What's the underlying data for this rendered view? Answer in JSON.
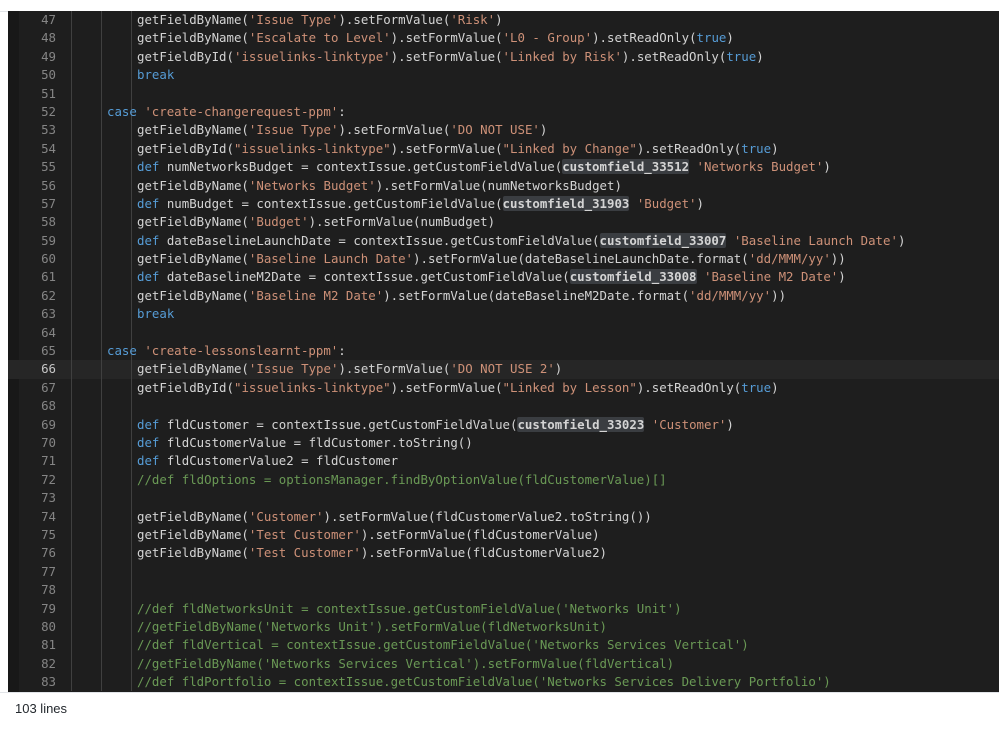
{
  "lines": [
    {
      "n": "47",
      "indent": 2,
      "segs": [
        [
          "t",
          "getFieldByName("
        ],
        [
          "s",
          "'Issue Type'"
        ],
        [
          "t",
          ").setFormValue("
        ],
        [
          "s",
          "'Risk'"
        ],
        [
          "t",
          ")"
        ]
      ]
    },
    {
      "n": "48",
      "indent": 2,
      "segs": [
        [
          "t",
          "getFieldByName("
        ],
        [
          "s",
          "'Escalate to Level'"
        ],
        [
          "t",
          ").setFormValue("
        ],
        [
          "s",
          "'L0 - Group'"
        ],
        [
          "t",
          ").setReadOnly("
        ],
        [
          "k",
          "true"
        ],
        [
          "t",
          ")"
        ]
      ]
    },
    {
      "n": "49",
      "indent": 2,
      "segs": [
        [
          "t",
          "getFieldById("
        ],
        [
          "s",
          "'issuelinks-linktype'"
        ],
        [
          "t",
          ").setFormValue("
        ],
        [
          "s",
          "'Linked by Risk'"
        ],
        [
          "t",
          ").setReadOnly("
        ],
        [
          "k",
          "true"
        ],
        [
          "t",
          ")"
        ]
      ]
    },
    {
      "n": "50",
      "indent": 2,
      "segs": [
        [
          "k",
          "break"
        ]
      ]
    },
    {
      "n": "51",
      "indent": 0,
      "segs": []
    },
    {
      "n": "52",
      "indent": 1,
      "segs": [
        [
          "k",
          "case "
        ],
        [
          "s",
          "'create-changerequest-ppm'"
        ],
        [
          "t",
          ":"
        ]
      ]
    },
    {
      "n": "53",
      "indent": 2,
      "segs": [
        [
          "t",
          "getFieldByName("
        ],
        [
          "s",
          "'Issue Type'"
        ],
        [
          "t",
          ").setFormValue("
        ],
        [
          "s",
          "'DO NOT USE'"
        ],
        [
          "t",
          ")"
        ]
      ]
    },
    {
      "n": "54",
      "indent": 2,
      "segs": [
        [
          "t",
          "getFieldById("
        ],
        [
          "s",
          "\"issuelinks-linktype\""
        ],
        [
          "t",
          ").setFormValue("
        ],
        [
          "s",
          "\"Linked by Change\""
        ],
        [
          "t",
          ").setReadOnly("
        ],
        [
          "k",
          "true"
        ],
        [
          "t",
          ")"
        ]
      ]
    },
    {
      "n": "55",
      "indent": 2,
      "segs": [
        [
          "k",
          "def "
        ],
        [
          "t",
          "numNetworksBudget = contextIssue.getCustomFieldValue("
        ],
        [
          "h",
          "customfield_33512"
        ],
        [
          "t",
          " "
        ],
        [
          "s",
          "'Networks Budget'"
        ],
        [
          "t",
          ")"
        ]
      ]
    },
    {
      "n": "56",
      "indent": 2,
      "segs": [
        [
          "t",
          "getFieldByName("
        ],
        [
          "s",
          "'Networks Budget'"
        ],
        [
          "t",
          ").setFormValue(numNetworksBudget)"
        ]
      ]
    },
    {
      "n": "57",
      "indent": 2,
      "segs": [
        [
          "k",
          "def "
        ],
        [
          "t",
          "numBudget = contextIssue.getCustomFieldValue("
        ],
        [
          "h",
          "customfield_31903"
        ],
        [
          "t",
          " "
        ],
        [
          "s",
          "'Budget'"
        ],
        [
          "t",
          ")"
        ]
      ]
    },
    {
      "n": "58",
      "indent": 2,
      "segs": [
        [
          "t",
          "getFieldByName("
        ],
        [
          "s",
          "'Budget'"
        ],
        [
          "t",
          ").setFormValue(numBudget)"
        ]
      ]
    },
    {
      "n": "59",
      "indent": 2,
      "segs": [
        [
          "k",
          "def "
        ],
        [
          "t",
          "dateBaselineLaunchDate = contextIssue.getCustomFieldValue("
        ],
        [
          "h",
          "customfield_33007"
        ],
        [
          "t",
          " "
        ],
        [
          "s",
          "'Baseline Launch Date'"
        ],
        [
          "t",
          ")"
        ]
      ]
    },
    {
      "n": "60",
      "indent": 2,
      "segs": [
        [
          "t",
          "getFieldByName("
        ],
        [
          "s",
          "'Baseline Launch Date'"
        ],
        [
          "t",
          ").setFormValue(dateBaselineLaunchDate.format("
        ],
        [
          "s",
          "'dd/MMM/yy'"
        ],
        [
          "t",
          "))"
        ]
      ]
    },
    {
      "n": "61",
      "indent": 2,
      "segs": [
        [
          "k",
          "def "
        ],
        [
          "t",
          "dateBaselineM2Date = contextIssue.getCustomFieldValue("
        ],
        [
          "h",
          "customfield_33008"
        ],
        [
          "t",
          " "
        ],
        [
          "s",
          "'Baseline M2 Date'"
        ],
        [
          "t",
          ")"
        ]
      ]
    },
    {
      "n": "62",
      "indent": 2,
      "segs": [
        [
          "t",
          "getFieldByName("
        ],
        [
          "s",
          "'Baseline M2 Date'"
        ],
        [
          "t",
          ").setFormValue(dateBaselineM2Date.format("
        ],
        [
          "s",
          "'dd/MMM/yy'"
        ],
        [
          "t",
          "))"
        ]
      ]
    },
    {
      "n": "63",
      "indent": 2,
      "segs": [
        [
          "k",
          "break"
        ]
      ]
    },
    {
      "n": "64",
      "indent": 0,
      "segs": []
    },
    {
      "n": "65",
      "indent": 1,
      "segs": [
        [
          "k",
          "case "
        ],
        [
          "s",
          "'create-lessonslearnt-ppm'"
        ],
        [
          "t",
          ":"
        ]
      ]
    },
    {
      "n": "66",
      "indent": 2,
      "active": true,
      "segs": [
        [
          "t",
          "getFieldByName("
        ],
        [
          "s",
          "'Issue Type'"
        ],
        [
          "t",
          ").setFormValue("
        ],
        [
          "s",
          "'DO NOT USE 2'"
        ],
        [
          "t",
          ")"
        ]
      ]
    },
    {
      "n": "67",
      "indent": 2,
      "segs": [
        [
          "t",
          "getFieldById("
        ],
        [
          "s",
          "\"issuelinks-linktype\""
        ],
        [
          "t",
          ").setFormValue("
        ],
        [
          "s",
          "\"Linked by Lesson\""
        ],
        [
          "t",
          ").setReadOnly("
        ],
        [
          "k",
          "true"
        ],
        [
          "t",
          ")"
        ]
      ]
    },
    {
      "n": "68",
      "indent": 0,
      "segs": []
    },
    {
      "n": "69",
      "indent": 2,
      "segs": [
        [
          "k",
          "def "
        ],
        [
          "t",
          "fldCustomer = contextIssue.getCustomFieldValue("
        ],
        [
          "h",
          "customfield_33023"
        ],
        [
          "t",
          " "
        ],
        [
          "s",
          "'Customer'"
        ],
        [
          "t",
          ")"
        ]
      ]
    },
    {
      "n": "70",
      "indent": 2,
      "segs": [
        [
          "k",
          "def "
        ],
        [
          "t",
          "fldCustomerValue = fldCustomer.toString()"
        ]
      ]
    },
    {
      "n": "71",
      "indent": 2,
      "segs": [
        [
          "k",
          "def "
        ],
        [
          "t",
          "fldCustomerValue2 = fldCustomer"
        ]
      ]
    },
    {
      "n": "72",
      "indent": 2,
      "segs": [
        [
          "c",
          "//def fldOptions = optionsManager.findByOptionValue(fldCustomerValue)[]"
        ]
      ]
    },
    {
      "n": "73",
      "indent": 0,
      "segs": []
    },
    {
      "n": "74",
      "indent": 2,
      "segs": [
        [
          "t",
          "getFieldByName("
        ],
        [
          "s",
          "'Customer'"
        ],
        [
          "t",
          ").setFormValue(fldCustomerValue2.toString())"
        ]
      ]
    },
    {
      "n": "75",
      "indent": 2,
      "segs": [
        [
          "t",
          "getFieldByName("
        ],
        [
          "s",
          "'Test Customer'"
        ],
        [
          "t",
          ").setFormValue(fldCustomerValue)"
        ]
      ]
    },
    {
      "n": "76",
      "indent": 2,
      "segs": [
        [
          "t",
          "getFieldByName("
        ],
        [
          "s",
          "'Test Customer'"
        ],
        [
          "t",
          ").setFormValue(fldCustomerValue2)"
        ]
      ]
    },
    {
      "n": "77",
      "indent": 0,
      "segs": []
    },
    {
      "n": "78",
      "indent": 0,
      "segs": []
    },
    {
      "n": "79",
      "indent": 2,
      "segs": [
        [
          "c",
          "//def fldNetworksUnit = contextIssue.getCustomFieldValue('Networks Unit')"
        ]
      ]
    },
    {
      "n": "80",
      "indent": 2,
      "segs": [
        [
          "c",
          "//getFieldByName('Networks Unit').setFormValue(fldNetworksUnit)"
        ]
      ]
    },
    {
      "n": "81",
      "indent": 2,
      "segs": [
        [
          "c",
          "//def fldVertical = contextIssue.getCustomFieldValue('Networks Services Vertical')"
        ]
      ]
    },
    {
      "n": "82",
      "indent": 2,
      "segs": [
        [
          "c",
          "//getFieldByName('Networks Services Vertical').setFormValue(fldVertical)"
        ]
      ]
    },
    {
      "n": "83",
      "indent": 2,
      "segs": [
        [
          "c",
          "//def fldPortfolio = contextIssue.getCustomFieldValue('Networks Services Delivery Portfolio')"
        ]
      ]
    }
  ],
  "footer": {
    "line_count": "103 lines"
  }
}
